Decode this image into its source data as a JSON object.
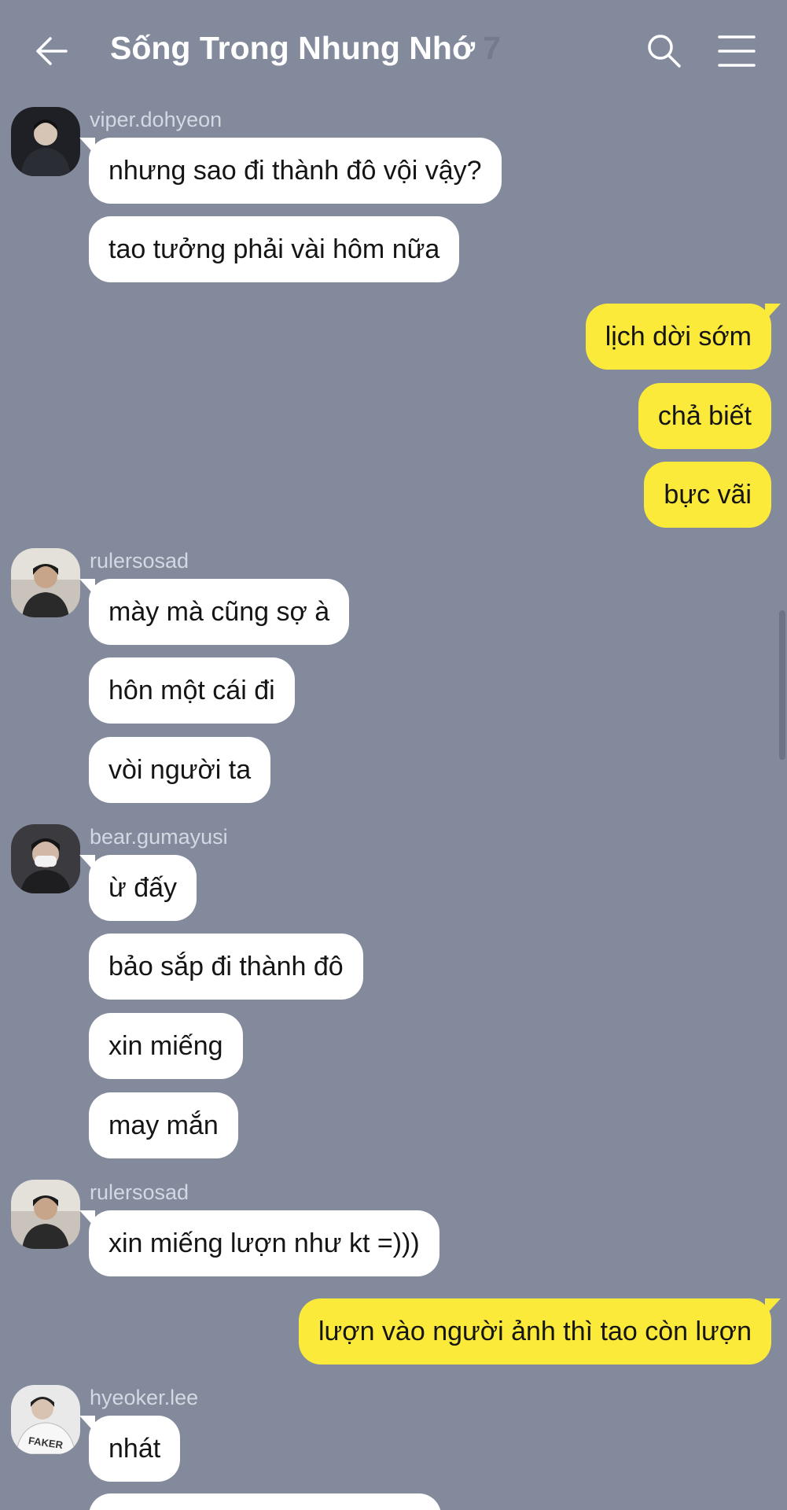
{
  "header": {
    "title": "Sống Trong Nhung Nhớ",
    "member_count": "7"
  },
  "messages": [
    {
      "sender": "viper.dohyeon",
      "avatar": "avatar-viper",
      "bubbles": [
        "nhưng sao đi thành đô vội vậy?",
        "tao tưởng phải vài hôm nữa"
      ]
    },
    {
      "sender": "me",
      "bubbles": [
        "lịch dời sớm",
        "chả biết",
        "bực vãi"
      ]
    },
    {
      "sender": "rulersosad",
      "avatar": "avatar-ruler",
      "bubbles": [
        "mày mà cũng sợ à",
        "hôn một cái đi",
        "vòi người ta"
      ]
    },
    {
      "sender": "bear.gumayusi",
      "avatar": "avatar-gumayusi",
      "bubbles": [
        "ừ đấy",
        "bảo sắp đi thành đô",
        "xin miếng",
        "may mắn"
      ]
    },
    {
      "sender": "rulersosad",
      "avatar": "avatar-ruler",
      "bubbles": [
        "xin miếng lượn như kt =)))"
      ]
    },
    {
      "sender": "me",
      "bubbles": [
        "lượn vào người ảnh thì tao còn lượn"
      ]
    },
    {
      "sender": "hyeoker.lee",
      "avatar": "avatar-faker",
      "bubbles": [
        "nhát"
      ]
    }
  ],
  "colors": {
    "background": "#828a9c",
    "incoming_bubble": "#ffffff",
    "outgoing_bubble": "#fcea3a"
  },
  "icons": {
    "back": "arrow-left-icon",
    "search": "search-icon",
    "menu": "menu-icon"
  }
}
